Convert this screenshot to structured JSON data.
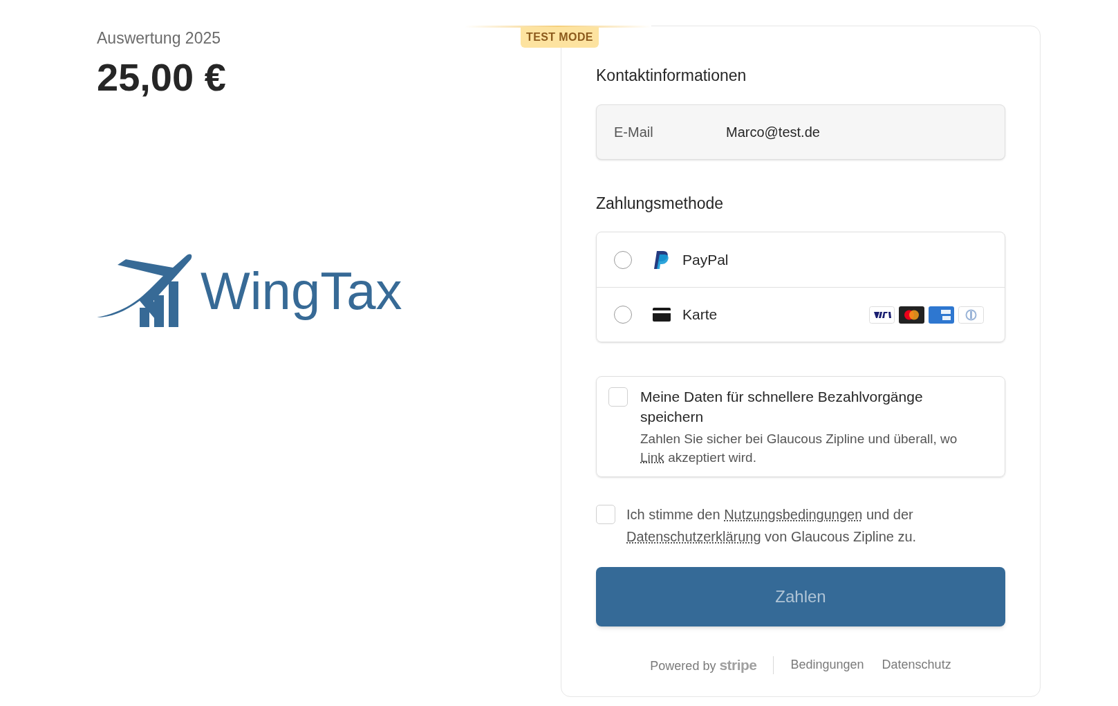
{
  "summary": {
    "label": "Auswertung 2025",
    "amount": "25,00 €"
  },
  "logo": {
    "text": "WingTax"
  },
  "test_badge": "TEST MODE",
  "contact": {
    "heading": "Kontaktinformationen",
    "email_label": "E-Mail",
    "email_value": "Marco@test.de"
  },
  "payment": {
    "heading": "Zahlungsmethode",
    "methods": [
      {
        "kind": "paypal",
        "label": "PayPal",
        "selected": false
      },
      {
        "kind": "card",
        "label": "Karte",
        "selected": false
      }
    ]
  },
  "save_option": {
    "checked": false,
    "title": "Meine Daten für schnellere Bezahlvorgänge speichern",
    "text_before": "Zahlen Sie sicher bei Glaucous Zipline und überall, wo ",
    "link": "Link",
    "text_after": " akzeptiert wird."
  },
  "terms": {
    "checked": false,
    "parts": [
      {
        "kind": "text",
        "text": "Ich stimme den "
      },
      {
        "kind": "link",
        "text": "Nutzungsbedingungen"
      },
      {
        "kind": "text",
        "text": " und der "
      },
      {
        "kind": "link",
        "text": "Datenschutzerklärung"
      },
      {
        "kind": "text",
        "text": " von Glaucous Zipline zu."
      }
    ]
  },
  "pay_button": "Zahlen",
  "footer": {
    "powered": "Powered by",
    "brand": "stripe",
    "links": [
      "Bedingungen",
      "Datenschutz"
    ]
  }
}
